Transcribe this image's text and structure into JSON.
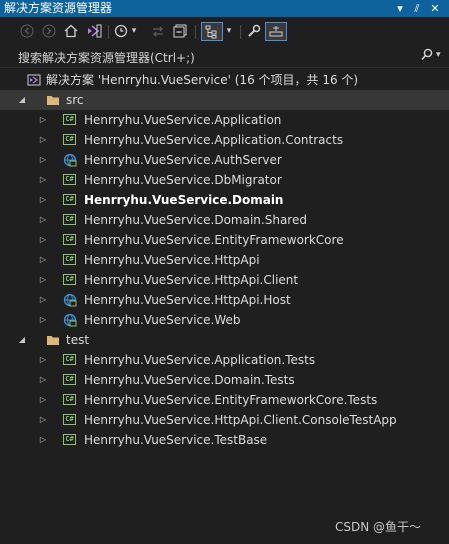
{
  "window": {
    "title": "解决方案资源管理器",
    "buttons": {
      "dropdown": "▾",
      "pin": "⫽",
      "close": "✕"
    }
  },
  "toolbar": {
    "icons": [
      "back-arrow-icon",
      "forward-arrow-icon",
      "home-icon",
      "vs-switch-views-icon",
      "history-icon",
      "pending-changes-icon",
      "collapse-all-icon",
      "show-all-files-icon",
      "properties-wrench-icon",
      "preview-selected-icon"
    ],
    "dropdown_glyph": "▾"
  },
  "search": {
    "placeholder": "搜索解决方案资源管理器(Ctrl+;)",
    "icon": "search-icon",
    "dropdown_glyph": "▾"
  },
  "solution": {
    "label": "解决方案 'Henrryhu.VueService' (16 个项目，共 16 个)",
    "icon": "solution-icon"
  },
  "folders": [
    {
      "name": "src",
      "expanded": true,
      "selected": true,
      "projects": [
        {
          "name": "Henrryhu.VueService.Application",
          "type": "csharp"
        },
        {
          "name": "Henrryhu.VueService.Application.Contracts",
          "type": "csharp"
        },
        {
          "name": "Henrryhu.VueService.AuthServer",
          "type": "web"
        },
        {
          "name": "Henrryhu.VueService.DbMigrator",
          "type": "csharp"
        },
        {
          "name": "Henrryhu.VueService.Domain",
          "type": "csharp",
          "bold": true
        },
        {
          "name": "Henrryhu.VueService.Domain.Shared",
          "type": "csharp"
        },
        {
          "name": "Henrryhu.VueService.EntityFrameworkCore",
          "type": "csharp"
        },
        {
          "name": "Henrryhu.VueService.HttpApi",
          "type": "csharp"
        },
        {
          "name": "Henrryhu.VueService.HttpApi.Client",
          "type": "csharp"
        },
        {
          "name": "Henrryhu.VueService.HttpApi.Host",
          "type": "web"
        },
        {
          "name": "Henrryhu.VueService.Web",
          "type": "web"
        }
      ]
    },
    {
      "name": "test",
      "expanded": true,
      "selected": false,
      "projects": [
        {
          "name": "Henrryhu.VueService.Application.Tests",
          "type": "csharp"
        },
        {
          "name": "Henrryhu.VueService.Domain.Tests",
          "type": "csharp"
        },
        {
          "name": "Henrryhu.VueService.EntityFrameworkCore.Tests",
          "type": "csharp"
        },
        {
          "name": "Henrryhu.VueService.HttpApi.Client.ConsoleTestApp",
          "type": "csharp"
        },
        {
          "name": "Henrryhu.VueService.TestBase",
          "type": "csharp"
        }
      ]
    }
  ],
  "watermark": "CSDN @鱼干～",
  "colors": {
    "title_bar": "#0e639c",
    "background": "#1f1f1f",
    "selection": "#373737",
    "csharp_icon": "#8fbf72",
    "folder_icon": "#dcb67a",
    "web_icon": "#3a96dd"
  }
}
